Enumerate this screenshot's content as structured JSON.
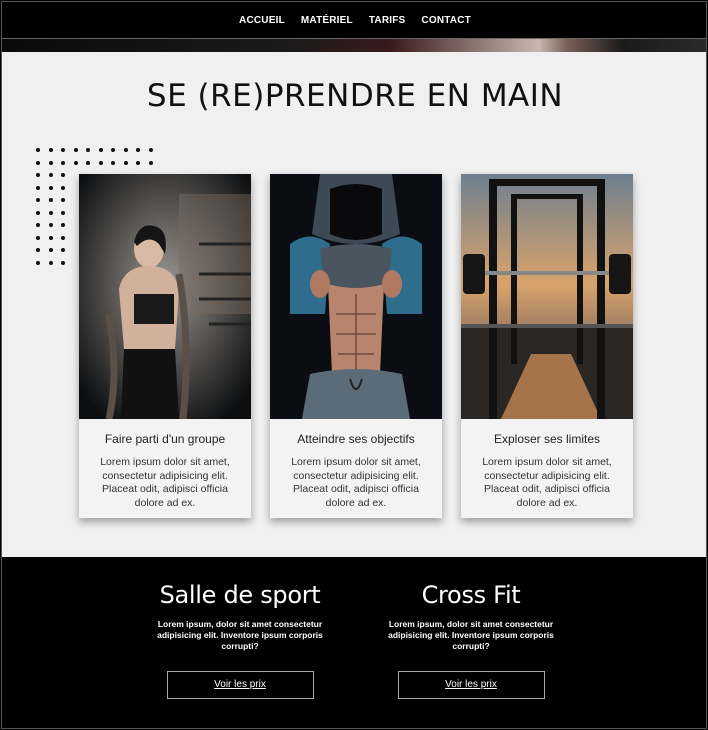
{
  "nav": {
    "items": [
      {
        "label": "ACCUEIL"
      },
      {
        "label": "MATÉRIEL"
      },
      {
        "label": "TARIFS"
      },
      {
        "label": "CONTACT"
      }
    ]
  },
  "main": {
    "title": "SE (RE)PRENDRE EN MAIN",
    "cards": [
      {
        "title": "Faire parti d'un groupe",
        "text": "Lorem ipsum dolor sit amet, consectetur adipisicing elit. Placeat odit, adipisci officia dolore ad ex.",
        "image": "woman-with-battle-ropes-photo"
      },
      {
        "title": "Atteindre ses objectifs",
        "text": "Lorem ipsum dolor sit amet, consectetur adipisicing elit. Placeat odit, adipisci officia dolore ad ex.",
        "image": "man-abs-hoodie-photo"
      },
      {
        "title": "Exploser ses limites",
        "text": "Lorem ipsum dolor sit amet, consectetur adipisicing elit. Placeat odit, adipisci officia dolore ad ex.",
        "image": "squat-rack-barbell-photo"
      }
    ]
  },
  "offers": [
    {
      "title": "Salle de sport",
      "text": "Lorem ipsum, dolor sit amet consectetur adipisicing elit. Inventore ipsum corporis corrupti?",
      "button": "Voir les prix"
    },
    {
      "title": "Cross Fit",
      "text": "Lorem ipsum, dolor sit amet consectetur adipisicing elit. Inventore ipsum corporis corrupti?",
      "button": "Voir les prix"
    }
  ],
  "colors": {
    "nav_bg": "#000000",
    "section_bg": "#f0f0f0",
    "bottom_bg": "#000000"
  }
}
